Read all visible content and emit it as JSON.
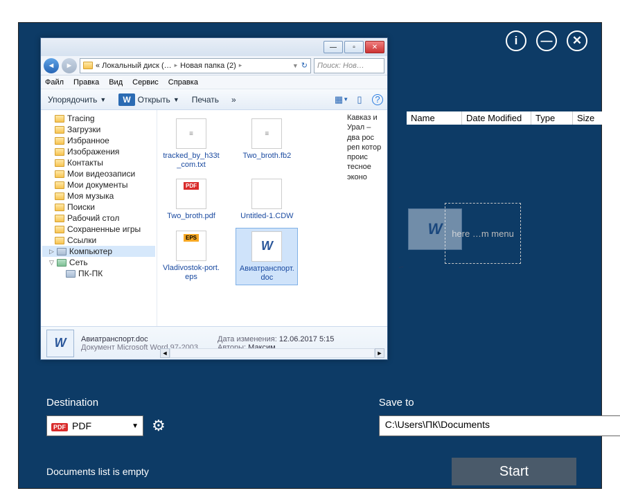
{
  "app": {
    "info_tip": "i",
    "minimize_tip": "—",
    "close_tip": "✕"
  },
  "columns": {
    "name": "Name",
    "date": "Date Modified",
    "type": "Type",
    "size": "Size"
  },
  "drop": {
    "hint": "here\n…m menu"
  },
  "bottom": {
    "dest_label": "Destination",
    "dest_value": "PDF",
    "saveto_label": "Save to",
    "saveto_value": "C:\\Users\\ПК\\Documents",
    "browse": "...",
    "status": "Documents list is empty",
    "start": "Start"
  },
  "explorer": {
    "addr_crumb1": "« Локальный диск (…",
    "addr_crumb2": "Новая папка (2)",
    "search_placeholder": "Поиск: Нов…",
    "menu": {
      "file": "Файл",
      "edit": "Правка",
      "view": "Вид",
      "service": "Сервис",
      "help": "Справка"
    },
    "toolbar": {
      "organize": "Упорядочить",
      "open": "Открыть",
      "print": "Печать",
      "more": "»"
    },
    "tree": [
      "Tracing",
      "Загрузки",
      "Избранное",
      "Изображения",
      "Контакты",
      "Мои видеозаписи",
      "Мои документы",
      "Моя музыка",
      "Поиски",
      "Рабочий стол",
      "Сохраненные игры",
      "Ссылки"
    ],
    "tree_special": {
      "computer": "Компьютер",
      "network": "Сеть",
      "pcpc": "ПК-ПК"
    },
    "files": [
      {
        "name": "tracked_by_h33t_com.txt",
        "kind": "txt"
      },
      {
        "name": "Two_broth.fb2",
        "kind": "txt"
      },
      {
        "name": "Two_broth.pdf",
        "kind": "pdf"
      },
      {
        "name": "Untitled-1.CDW",
        "kind": "txt"
      },
      {
        "name": "Vladivostok-port.eps",
        "kind": "eps"
      },
      {
        "name": "Авиатранспорт.doc",
        "kind": "doc",
        "selected": true
      }
    ],
    "sidetext": "Кавказ и Урал – два рос реп котор проис тесное эконо",
    "details": {
      "filename": "Авиатранспорт.doc",
      "filetype": "Документ Microsoft Word 97-2003",
      "k_date": "Дата изменения:",
      "v_date": "12.06.2017 5:15",
      "k_auth": "Авторы:",
      "v_auth": "Максим"
    }
  }
}
